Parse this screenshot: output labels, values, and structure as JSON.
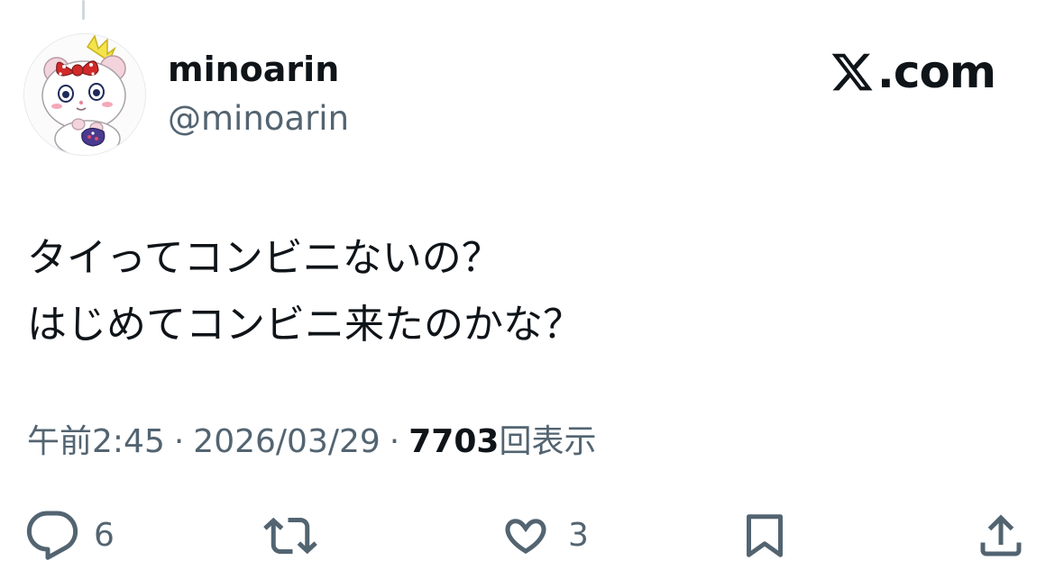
{
  "author": {
    "display_name": "minoarin",
    "handle": "@minoarin",
    "avatar_icon": "hamster-character-avatar"
  },
  "brand": {
    "icon": "x-logo-icon",
    "text": ".com"
  },
  "tweet": {
    "lines": [
      "タイってコンビニないの？",
      "はじめてコンビニ来たのかな？"
    ]
  },
  "meta": {
    "time": "午前2:45",
    "separator": "·",
    "date": "2026/03/29",
    "views_count": "7703",
    "views_label": "回表示"
  },
  "actions": {
    "reply": {
      "icon": "reply-bubble-icon",
      "count": "6"
    },
    "repost": {
      "icon": "repost-icon",
      "count": ""
    },
    "like": {
      "icon": "heart-icon",
      "count": "3"
    },
    "bookmark": {
      "icon": "bookmark-icon",
      "count": ""
    },
    "share": {
      "icon": "share-icon",
      "count": ""
    }
  },
  "colors": {
    "text_primary": "#0f1419",
    "text_secondary": "#536471",
    "thread_line": "#cfd9de",
    "background": "#ffffff"
  }
}
